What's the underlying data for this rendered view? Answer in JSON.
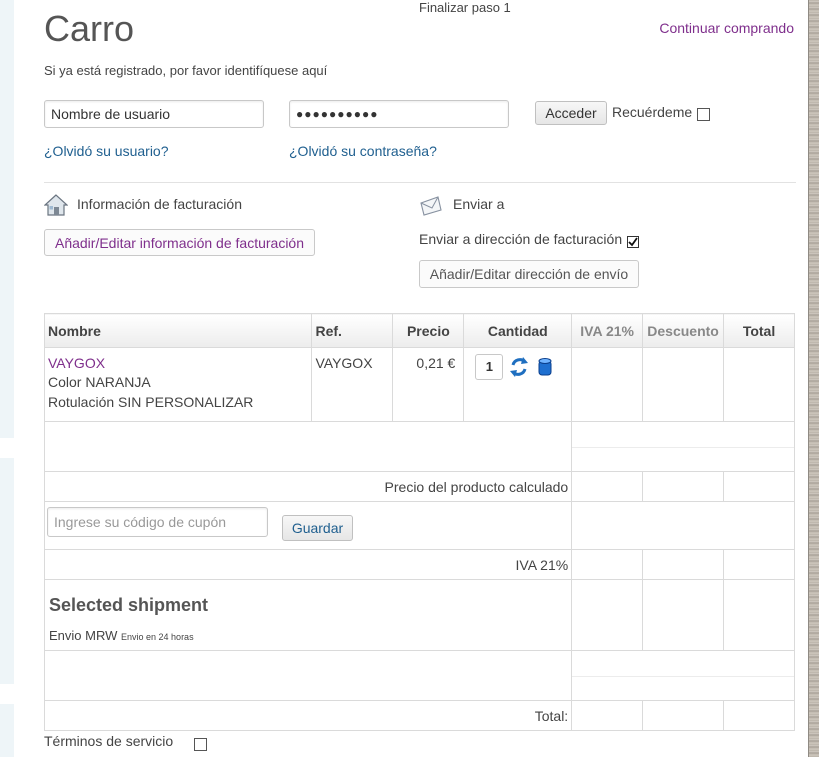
{
  "page": {
    "step_label": "Finalizar paso 1",
    "title": "Carro",
    "continue_link": "Continuar comprando",
    "login_hint": "Si ya está registrado, por favor identifíquese aquí"
  },
  "login": {
    "username_value": "Nombre de usuario",
    "password_value": "●●●●●●●●●●",
    "submit_label": "Acceder",
    "remember_label": "Recuérdeme",
    "forgot_user": "¿Olvidó su usuario?",
    "forgot_password": "¿Olvidó su contraseña?"
  },
  "billing": {
    "title": "Información de facturación",
    "edit_button": "Añadir/Editar información de facturación",
    "icon": "house-icon"
  },
  "shipping": {
    "title": "Enviar a",
    "same_address_label": "Enviar a dirección de facturación",
    "same_address_checked": true,
    "edit_button": "Añadir/Editar dirección de envío",
    "icon": "envelope-icon"
  },
  "cart": {
    "headers": {
      "name": "Nombre",
      "ref": "Ref.",
      "price": "Precio",
      "quantity": "Cantidad",
      "tax": "IVA 21%",
      "discount": "Descuento",
      "total": "Total"
    },
    "items": [
      {
        "name": "VAYGOX",
        "variant_color": "Color NARANJA",
        "variant_label": "Rotulación SIN PERSONALIZAR",
        "ref": "VAYGOX",
        "price": "0,21 €",
        "quantity": "1"
      }
    ],
    "product_price_label": "Precio del producto calculado",
    "coupon_placeholder": "Ingrese su código de cupón",
    "coupon_button": "Guardar",
    "tax_label": "IVA 21%",
    "shipment_title": "Selected shipment",
    "shipment_method": "Envio MRW",
    "shipment_note": "Envio en 24 horas",
    "total_label": "Total:"
  },
  "terms": {
    "label": "Términos de servicio"
  }
}
